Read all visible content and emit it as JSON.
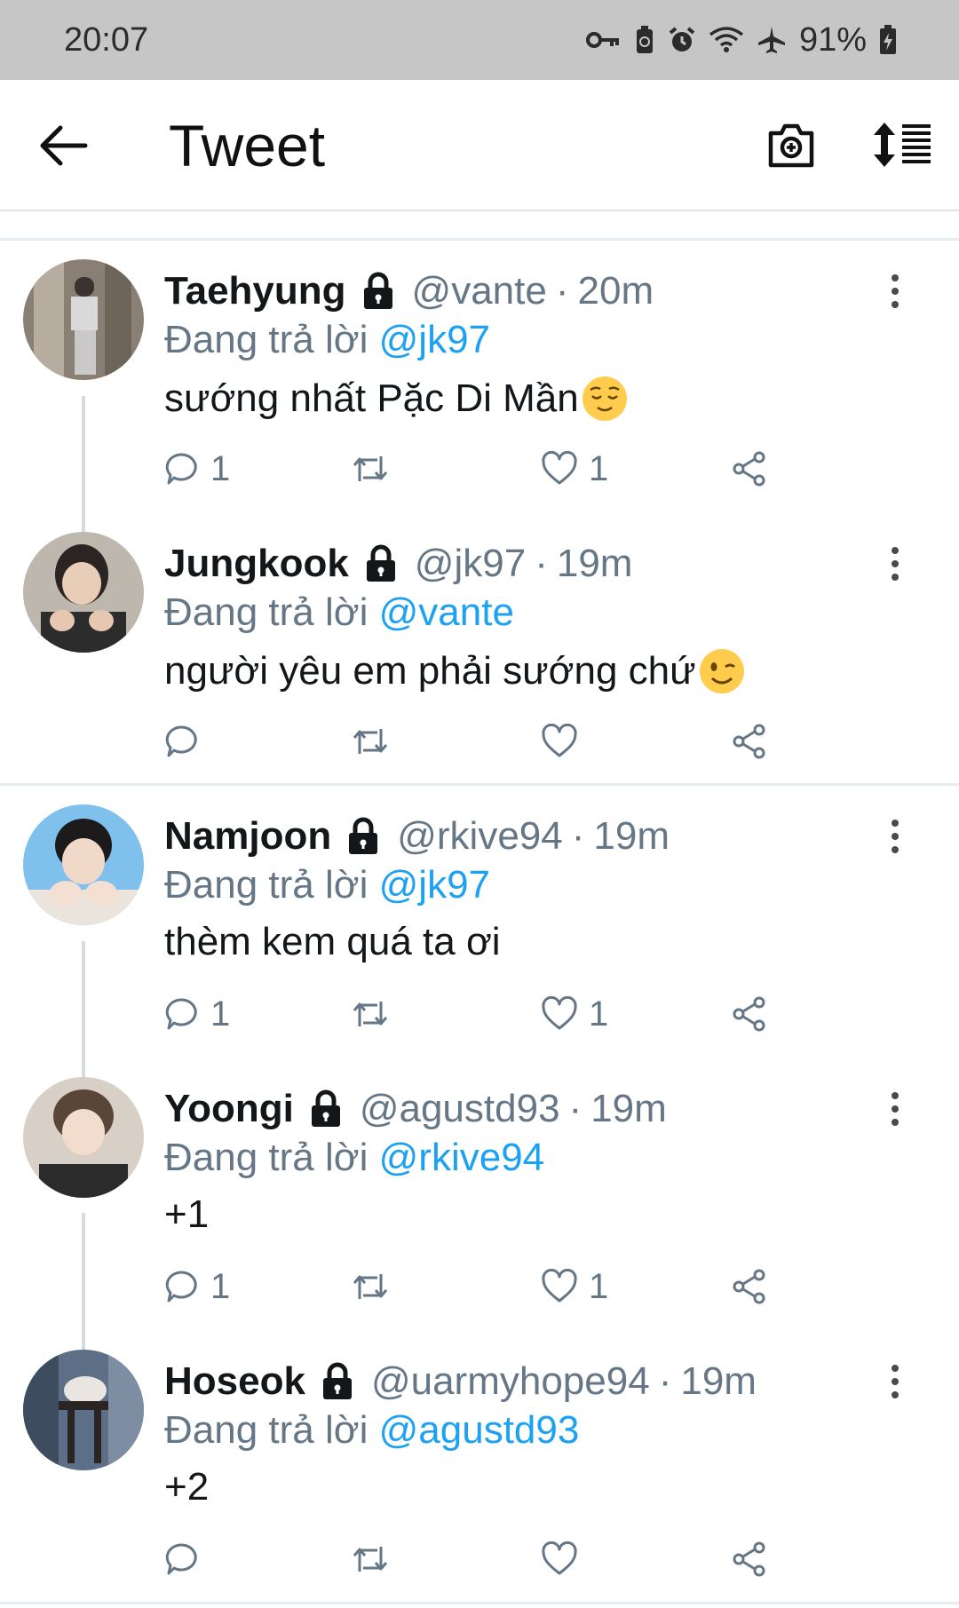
{
  "status_bar": {
    "time": "20:07",
    "battery": "91%"
  },
  "app_bar": {
    "title": "Tweet"
  },
  "colors": {
    "accent": "#1da1f2",
    "muted": "#657786",
    "text": "#14171a",
    "status_bar_bg": "#c6c6c6"
  },
  "tweets": [
    {
      "name": "Taehyung",
      "handle": "@vante",
      "time": "20m",
      "reply_prefix": "Đang trả lời",
      "reply_to": "@jk97",
      "text": "sướng nhất Pặc Di Mần",
      "emoji": "relieved-face",
      "reply_count": "1",
      "retweet_count": "",
      "like_count": "1"
    },
    {
      "name": "Jungkook",
      "handle": "@jk97",
      "time": "19m",
      "reply_prefix": "Đang trả lời",
      "reply_to": "@vante",
      "text": "người yêu em phải sướng chứ",
      "emoji": "winking-face",
      "reply_count": "",
      "retweet_count": "",
      "like_count": ""
    },
    {
      "name": "Namjoon",
      "handle": "@rkive94",
      "time": "19m",
      "reply_prefix": "Đang trả lời",
      "reply_to": "@jk97",
      "text": "thèm kem quá ta ơi",
      "emoji": "",
      "reply_count": "1",
      "retweet_count": "",
      "like_count": "1"
    },
    {
      "name": "Yoongi",
      "handle": "@agustd93",
      "time": "19m",
      "reply_prefix": "Đang trả lời",
      "reply_to": "@rkive94",
      "text": "+1",
      "emoji": "",
      "reply_count": "1",
      "retweet_count": "",
      "like_count": "1"
    },
    {
      "name": "Hoseok",
      "handle": "@uarmyhope94",
      "time": "19m",
      "reply_prefix": "Đang trả lời",
      "reply_to": "@agustd93",
      "text": "+2",
      "emoji": "",
      "reply_count": "",
      "retweet_count": "",
      "like_count": ""
    }
  ],
  "sep": "·"
}
